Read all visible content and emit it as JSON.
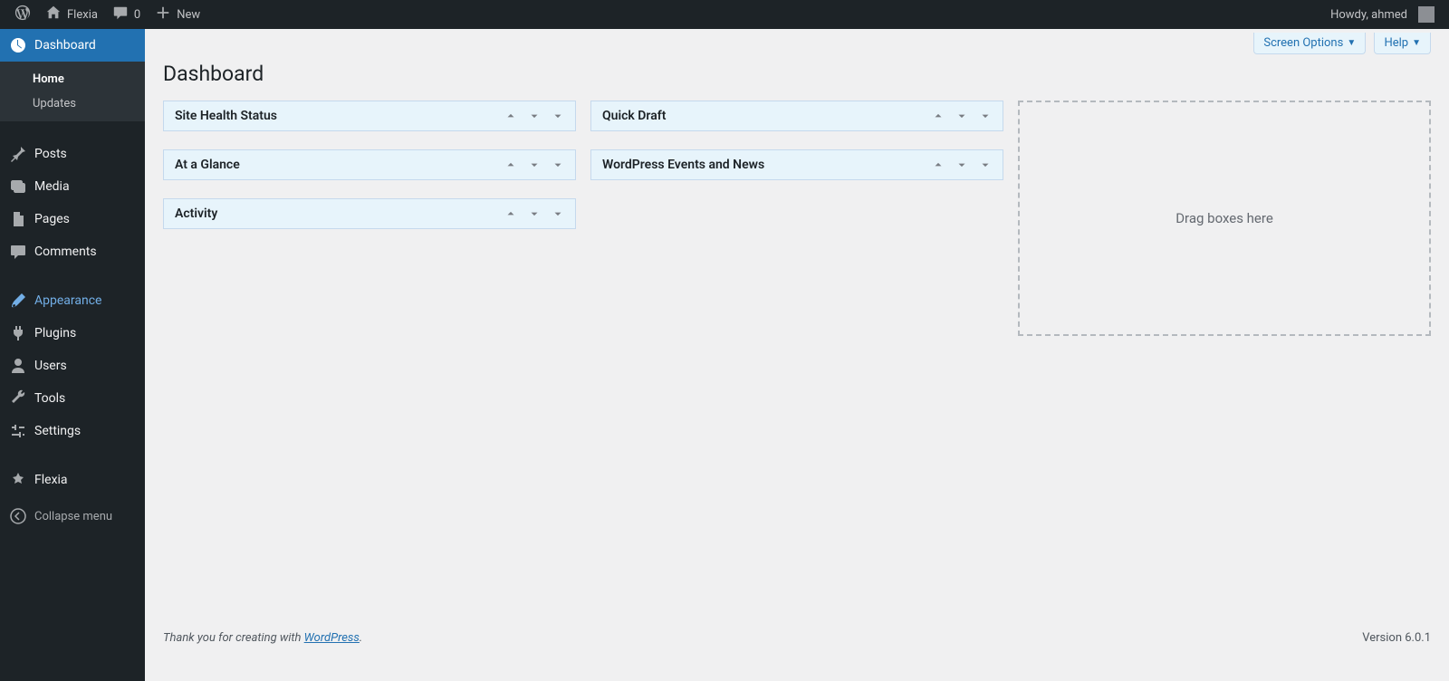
{
  "adminbar": {
    "site_name": "Flexia",
    "comment_count": "0",
    "new_label": "New",
    "howdy": "Howdy, ahmed"
  },
  "sidebar": {
    "dashboard": "Dashboard",
    "submenu": {
      "home": "Home",
      "updates": "Updates"
    },
    "posts": "Posts",
    "media": "Media",
    "pages": "Pages",
    "comments": "Comments",
    "appearance": "Appearance",
    "plugins": "Plugins",
    "users": "Users",
    "tools": "Tools",
    "settings": "Settings",
    "flexia": "Flexia",
    "collapse": "Collapse menu"
  },
  "content": {
    "screen_options": "Screen Options",
    "help": "Help",
    "page_title": "Dashboard",
    "boxes": {
      "site_health": "Site Health Status",
      "at_a_glance": "At a Glance",
      "activity": "Activity",
      "quick_draft": "Quick Draft",
      "events_news": "WordPress Events and News"
    },
    "drag_placeholder": "Drag boxes here",
    "footer_prefix": "Thank you for creating with ",
    "footer_link": "WordPress",
    "footer_suffix": ".",
    "version": "Version 6.0.1"
  }
}
